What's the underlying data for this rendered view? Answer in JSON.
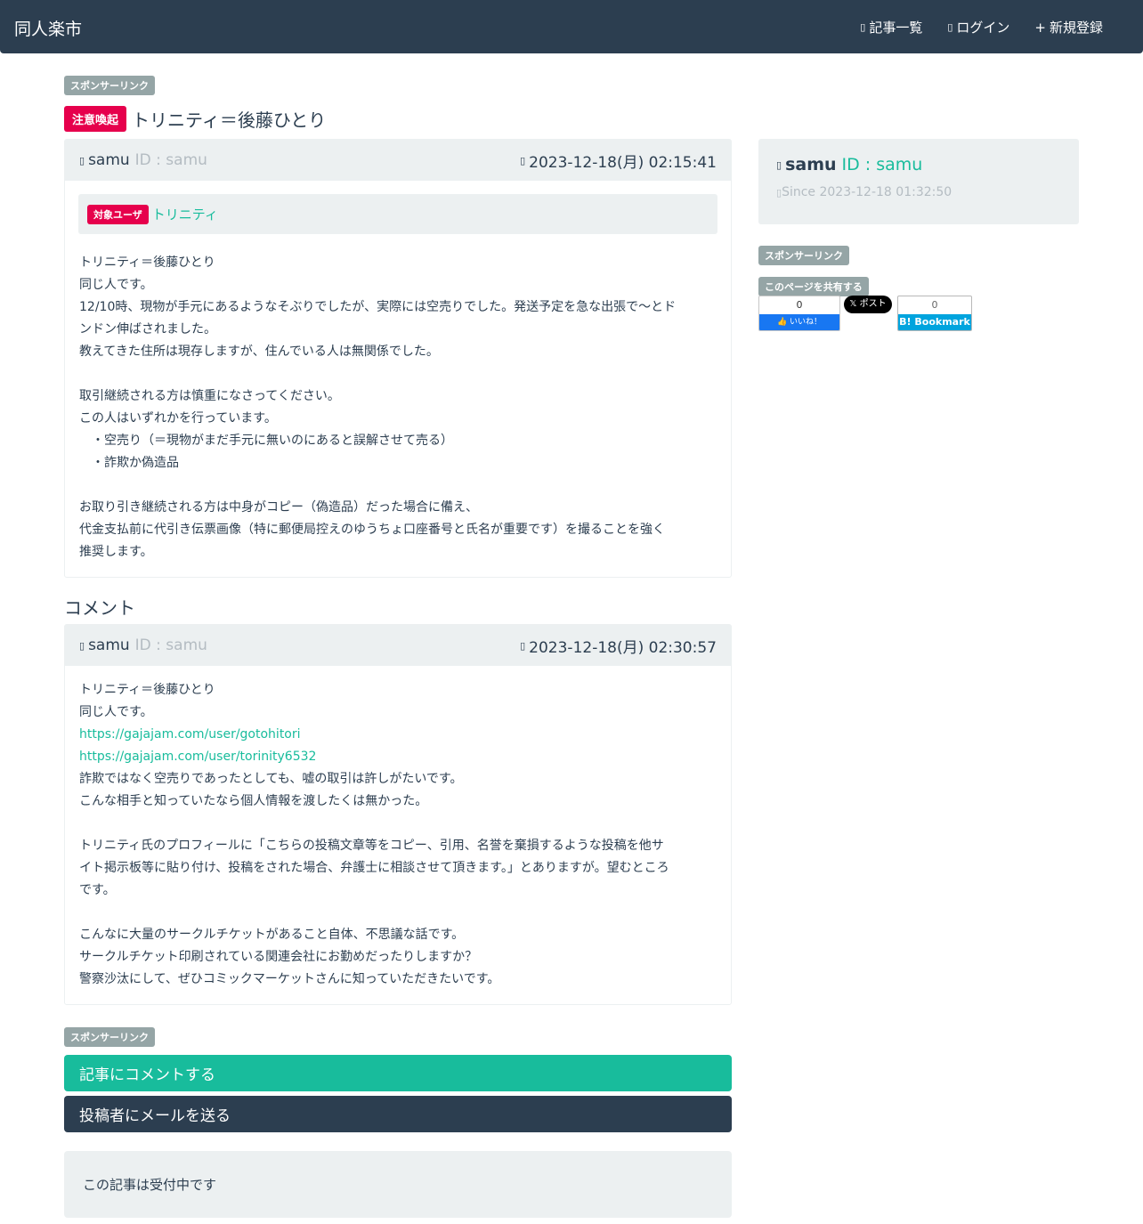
{
  "navbar": {
    "brand": "同人楽市",
    "links": [
      {
        "icon": "list-icon",
        "glyph": "▯",
        "label": "記事一覧"
      },
      {
        "icon": "login-icon",
        "glyph": "▯",
        "label": "ログイン"
      },
      {
        "icon": "plus-icon",
        "glyph": "+",
        "label": "新規登録"
      }
    ]
  },
  "sponsor_label": "スポンサーリンク",
  "article": {
    "badge": "注意喚起",
    "title": "トリニティ＝後藤ひとり",
    "author": "samu",
    "author_id": "ID : samu",
    "date": "2023-12-18(月) 02:15:41",
    "target_label": "対象ユーザ",
    "target_user": "トリニティ",
    "body": [
      "トリニティ＝後藤ひとり",
      "同じ人です。",
      "12/10時、現物が手元にあるようなそぶりでしたが、実際には空売りでした。発送予定を急な出張で〜とド",
      "ンドン伸ばされました。",
      "教えてきた住所は現存しますが、住んでいる人は無関係でした。",
      "",
      "取引継続される方は慎重になさってください。",
      "この人はいずれかを行っています。",
      "　・空売り（＝現物がまだ手元に無いのにあると誤解させて売る）",
      "　・詐欺か偽造品",
      "",
      "お取り引き継続される方は中身がコピー（偽造品）だった場合に備え、",
      "代金支払前に代引き伝票画像（特に郵便局控えのゆうちょ口座番号と氏名が重要です）を撮ることを強く",
      "推奨します。"
    ]
  },
  "comments_title": "コメント",
  "comment": {
    "author": "samu",
    "author_id": "ID : samu",
    "date": "2023-12-18(月) 02:30:57",
    "body_top": [
      "トリニティ＝後藤ひとり",
      "同じ人です。"
    ],
    "links": [
      "https://gajajam.com/user/gotohitori",
      "https://gajajam.com/user/torinity6532"
    ],
    "body_bottom": [
      "詐欺ではなく空売りであったとしても、嘘の取引は許しがたいです。",
      "こんな相手と知っていたなら個人情報を渡したくは無かった。",
      "",
      "トリニティ氏のプロフィールに「こちらの投稿文章等をコピー、引用、名誉を棄損するような投稿を他サ",
      "イト掲示板等に貼り付け、投稿をされた場合、弁護士に相談させて頂きます。」とありますが。望むところ",
      "です。",
      "",
      "こんなに大量のサークルチケットがあること自体、不思議な話です。",
      "サークルチケット印刷されている関連会社にお勤めだったりしますか？",
      "警察沙汰にして、ぜひコミックマーケットさんに知っていただきたいです。"
    ]
  },
  "buttons": {
    "comment": "記事にコメントする",
    "mail": "投稿者にメールを送る"
  },
  "status_text": "この記事は受付中です",
  "sidebar": {
    "name": "samu",
    "id": "ID : samu",
    "since": "Since 2023-12-18 01:32:50",
    "share_label": "このページを共有する",
    "fb_count": "0",
    "fb_like": "いいね！",
    "tw_label": "ポスト",
    "hb_count": "0",
    "hb_label": "B! Bookmark"
  },
  "colors": {
    "primary": "#2c3e50",
    "success": "#18bc9c",
    "danger": "#e6004c",
    "muted": "#95a5a6",
    "light": "#ecf0f1"
  }
}
